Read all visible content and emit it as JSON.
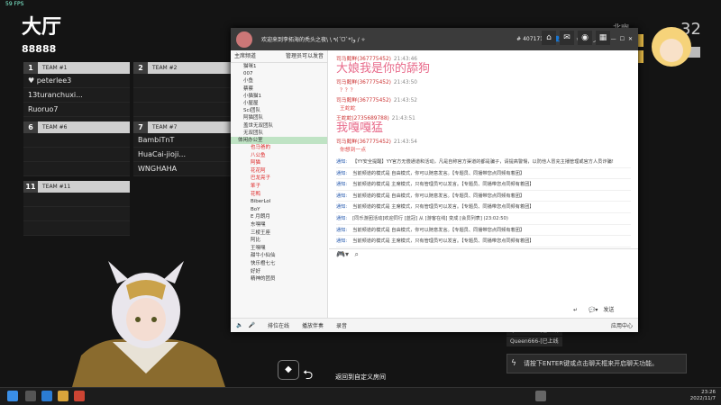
{
  "game": {
    "fps": "59 FPS",
    "lobby_title": "大厅",
    "room_id": "88888",
    "top_right_number": "32",
    "teams": [
      {
        "num": "1",
        "name": "TEAM #1",
        "members": [
          "peterlee3",
          "13turanchuxi...",
          "Ruoruo7"
        ]
      },
      {
        "num": "2",
        "name": "TEAM #2",
        "members": []
      },
      {
        "num": "6",
        "name": "TEAM #6",
        "members": []
      },
      {
        "num": "7",
        "name": "TEAM #7",
        "members": [
          "BambiTnT",
          "HuaCai-jioji...",
          "WNGHAHA"
        ]
      },
      {
        "num": "11",
        "name": "TEAM #11",
        "members": []
      }
    ],
    "back_label": "返回到自定义房间",
    "chat_lines": [
      "Queen666-[已上线",
      "Queen666-[已上线"
    ],
    "chat_placeholder": "请按下ENTER键或点击聊天框来开启聊天功能。"
  },
  "yy": {
    "title": "欢迎来到李拓海的秃头之夜\\ \\ ٩(ˊᗜˋ*)و / ✧",
    "room_number": "40717173",
    "online_count": "290",
    "left_header": "主席频道",
    "left_header_right": "管理员可以发音",
    "channels": [
      "猫咪1",
      "007",
      "小鱼",
      "蔡蔡",
      "小猫猫1",
      "小屋屋",
      "Sci团队",
      "阿猫团队",
      "盖世无双团队",
      "无双团队"
    ],
    "active_channel": "体闲办公室",
    "members": [
      "也马爸的",
      "八公鱼",
      "阿猫",
      "花花阿",
      "巴龙亮子",
      "笨子",
      "花鸭",
      "BiberLol",
      "BoY",
      "E 月朗月",
      "东嘿嘿",
      "三棱王座",
      "阿比",
      "王嘿嘿",
      "甜牛小仙仙",
      "快乐橙七七",
      "好好",
      "精神的团员"
    ],
    "messages": [
      {
        "user": "司马懿鲜(367775452)",
        "time": "21:43:46",
        "text": "大娘我是你的舔狗",
        "big": true
      },
      {
        "user": "司马懿鲜(367775452)",
        "time": "21:43:50",
        "text": "？？？",
        "big": false
      },
      {
        "user": "司马懿鲜(367775452)",
        "time": "21:43:52",
        "text": "王蛇蛇",
        "big": false
      },
      {
        "user": "王蛇蛇(2735689788)",
        "time": "21:43:51",
        "text": "我嘎嘎猛",
        "big": true
      },
      {
        "user": "司马懿鲜(367775452)",
        "time": "21:43:54",
        "text": "你想到一点",
        "big": false
      }
    ],
    "system_messages": [
      {
        "tag": "通知:",
        "text": "【YY安全提醒】YY官方无偿通道和活动，凡是自称官方渠道的都是骗子，请提高警惕，以防他人冒充主播管理或官方人员诈骗!"
      },
      {
        "tag": "通知:",
        "text": "当前频道的模式是 自由模式，你可以随意发言。【专题员、同播带您点同频有着团】"
      },
      {
        "tag": "通知:",
        "text": "当前频道的模式是 主席模式，只有管理员可以发言。【专题员、同播带您点同频有着团】"
      },
      {
        "tag": "通知:",
        "text": "当前频道的模式是 自由模式，你可以随意发言。【专题员、同播带您点同频有着团】"
      },
      {
        "tag": "通知:",
        "text": "当前频道的模式是 主席模式，只有管理员可以发言。【专题员、同播带您点同频有着团】"
      },
      {
        "tag": "通知:",
        "text": "[同乐游团活动]欢迎同行 [蓝冠] 从 [游客在线] 变成 [会员列表]  (23:02:50)"
      },
      {
        "tag": "通知:",
        "text": "当前频道的模式是 自由模式，你可以随意发言。【专题员、同播带您点同频有着团】"
      },
      {
        "tag": "通知:",
        "text": "当前频道的模式是 主席模式，只有管理员可以发言。【专题员、同播带您点同频有着团】"
      }
    ],
    "bottom_items": [
      "排位在线",
      "播放伴奏",
      "录音"
    ],
    "bottom_right": "应用中心",
    "send_label": "发送"
  },
  "taskbar": {
    "time": "23:26",
    "date": "2022/11/7"
  }
}
